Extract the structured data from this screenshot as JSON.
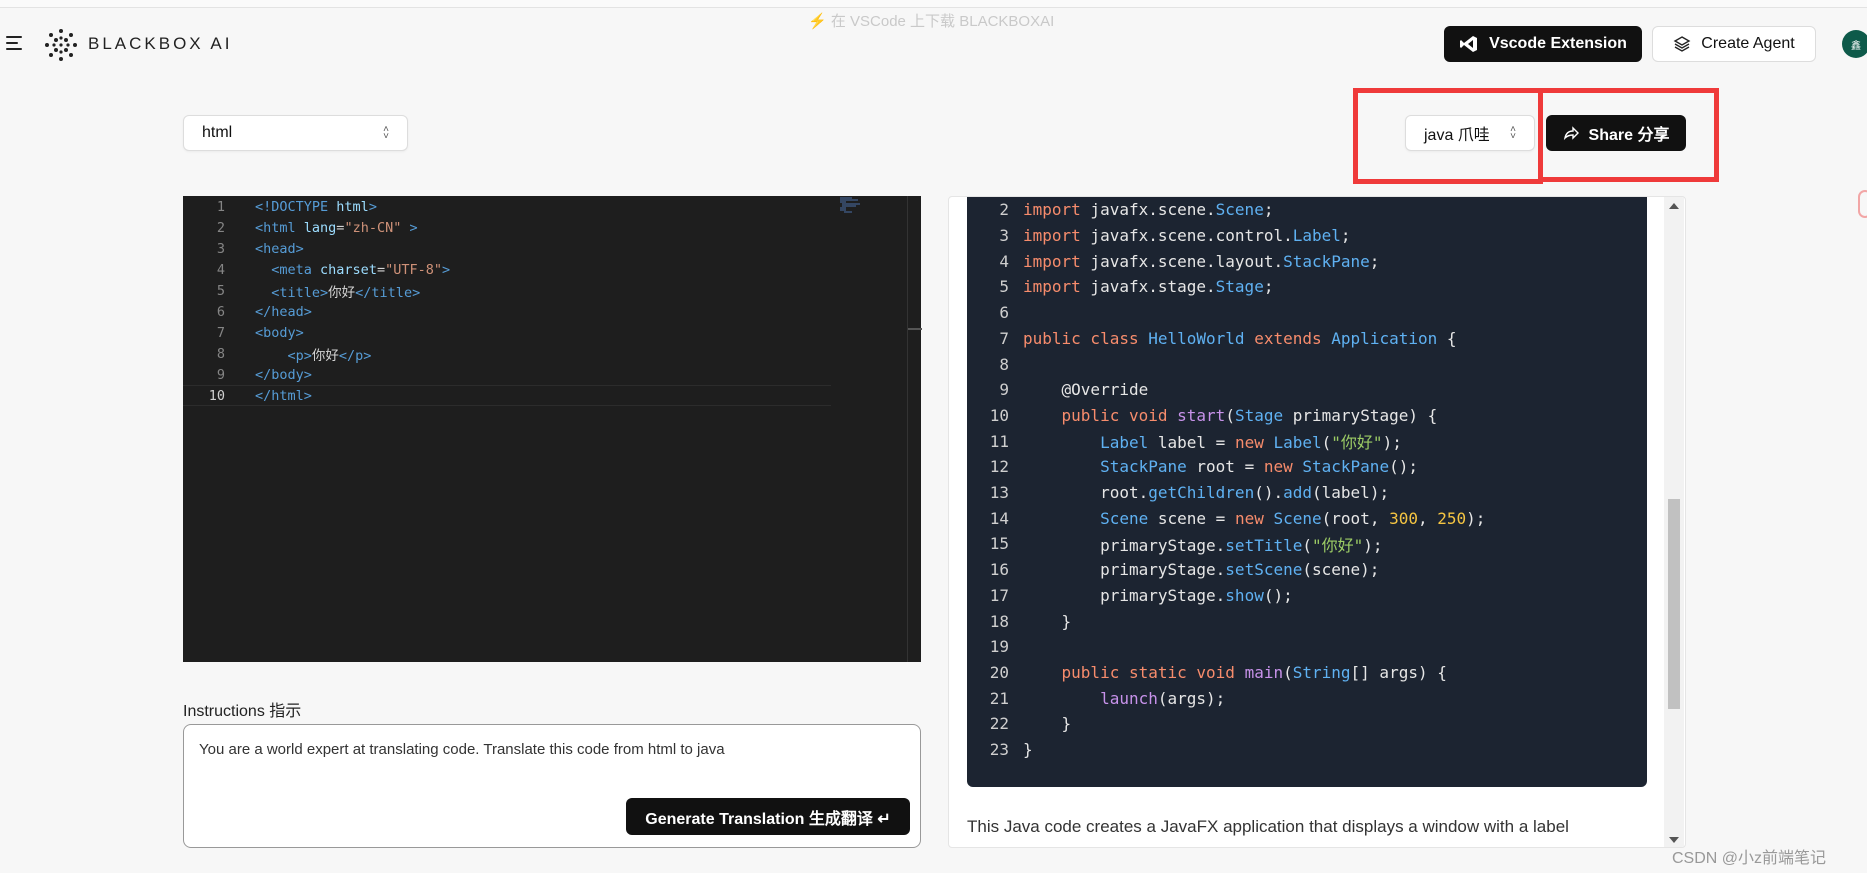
{
  "banner": {
    "text": "⚡ 在 VSCode 上下载 BLACKBOXAI"
  },
  "header": {
    "logo_text": "BLACKBOX AI",
    "vscode_button": "Vscode Extension",
    "agent_button": "Create Agent",
    "avatar_text": "鑫"
  },
  "source_language": {
    "selected": "html"
  },
  "target_language": {
    "selected": "java 爪哇"
  },
  "share_button": "Share 分享",
  "editor": {
    "line_numbers": [
      "1",
      "2",
      "3",
      "4",
      "5",
      "6",
      "7",
      "8",
      "9",
      "10"
    ]
  },
  "instructions": {
    "label": "Instructions 指示",
    "value": "You are a world expert at translating code. Translate this code from html to java",
    "generate_button": "Generate Translation  生成翻译 ↵"
  },
  "output": {
    "line_numbers": [
      "2",
      "3",
      "4",
      "5",
      "6",
      "7",
      "8",
      "9",
      "10",
      "11",
      "12",
      "13",
      "14",
      "15",
      "16",
      "17",
      "18",
      "19",
      "20",
      "21",
      "22",
      "23"
    ],
    "description": "This Java code creates a JavaFX application that displays a window with a label"
  },
  "watermark": "CSDN @小z前端笔记",
  "colors": {
    "accent_red": "#ef3a3a",
    "button_dark": "#111111",
    "code_bg": "#1c2431"
  }
}
